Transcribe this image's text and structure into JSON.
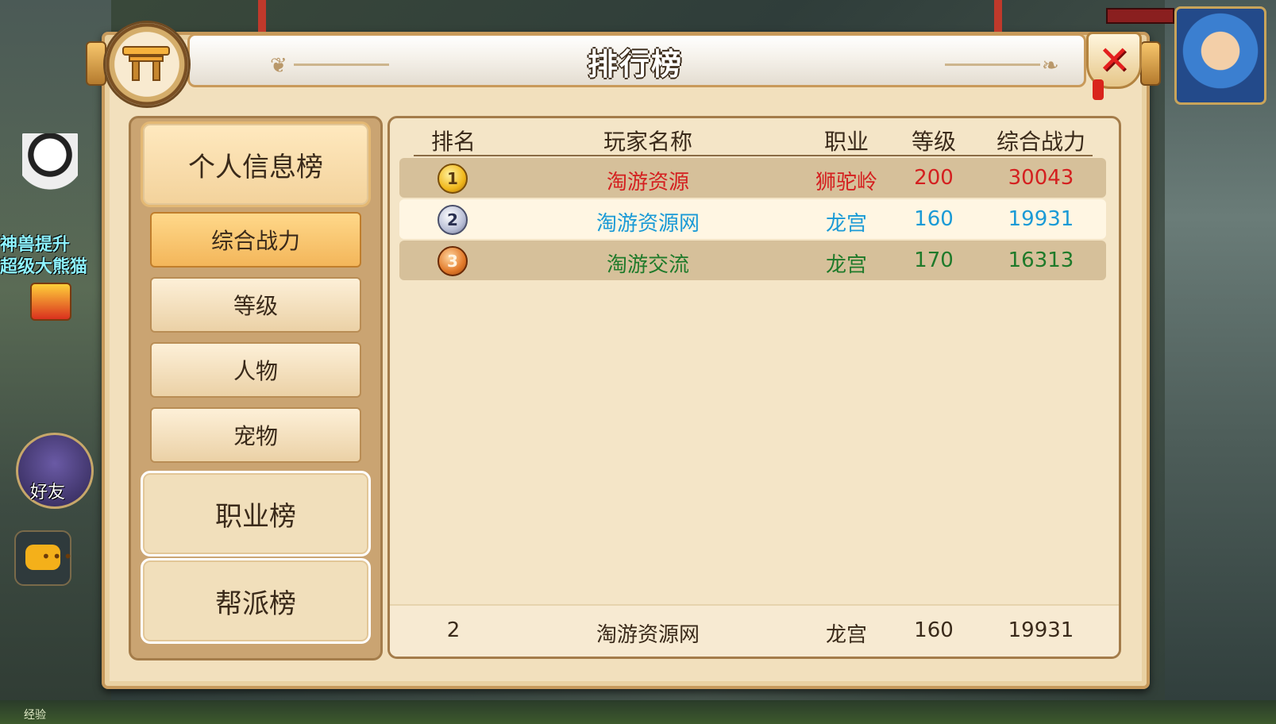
{
  "title": "排行榜",
  "categories": [
    {
      "label": "个人信息榜",
      "active": true
    },
    {
      "label": "职业榜",
      "active": false
    },
    {
      "label": "帮派榜",
      "active": false
    }
  ],
  "subtabs": [
    {
      "label": "综合战力",
      "active": true
    },
    {
      "label": "等级",
      "active": false
    },
    {
      "label": "人物",
      "active": false
    },
    {
      "label": "宠物",
      "active": false
    }
  ],
  "table": {
    "headers": [
      "排名",
      "玩家名称",
      "职业",
      "等级",
      "综合战力"
    ],
    "rows": [
      {
        "rank": "1",
        "name": "淘游资源",
        "class": "狮驼岭",
        "level": "200",
        "power": "30043",
        "color": "#d42020"
      },
      {
        "rank": "2",
        "name": "淘游资源网",
        "class": "龙宫",
        "level": "160",
        "power": "19931",
        "color": "#1a9ad6"
      },
      {
        "rank": "3",
        "name": "淘游交流",
        "class": "龙宫",
        "level": "170",
        "power": "16313",
        "color": "#1f7a2a"
      }
    ],
    "my_rank": {
      "rank": "2",
      "name": "淘游资源网",
      "class": "龙宫",
      "level": "160",
      "power": "19931"
    }
  },
  "background": {
    "side_text_1": "神兽提升",
    "side_text_2": "超级大熊猫",
    "friend_label": "好友",
    "exp_label": "经验"
  },
  "icons": {
    "close": "close-icon",
    "emblem": "gate-emblem-icon",
    "chat": "chat-icon",
    "gift": "gift-icon"
  }
}
